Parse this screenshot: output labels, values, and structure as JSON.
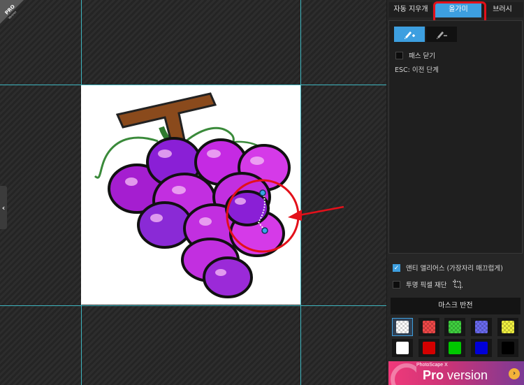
{
  "badge": {
    "line1": "PRO",
    "line2": "Version"
  },
  "tabs": [
    {
      "label": "자동 지우개"
    },
    {
      "label": "올가미"
    },
    {
      "label": "브러시"
    }
  ],
  "lasso": {
    "close_path_label": "패스 닫기",
    "esc_hint": "ESC: 이전 단계"
  },
  "options": {
    "antialias_label": "앤티 앨리어스 (가장자리 매끄럽게)",
    "antialias_checked": true,
    "crop_transparent_label": "투명 픽셀 재단"
  },
  "invert_mask_label": "마스크 반전",
  "mask_colors": [
    {
      "name": "transparent-checker",
      "color": "#ffffff"
    },
    {
      "name": "red-checker",
      "color": "#f04848"
    },
    {
      "name": "green-checker",
      "color": "#3fd13f"
    },
    {
      "name": "blue-checker",
      "color": "#6a6af0"
    },
    {
      "name": "yellow-checker",
      "color": "#f0f040"
    },
    {
      "name": "white",
      "color": "#ffffff"
    },
    {
      "name": "red",
      "color": "#d40000"
    },
    {
      "name": "green",
      "color": "#00c800"
    },
    {
      "name": "blue",
      "color": "#0000d8"
    },
    {
      "name": "black",
      "color": "#000000"
    }
  ],
  "ad": {
    "small": "PhotoScape X",
    "strong": "Pro",
    "rest": " version",
    "arrow": "›"
  },
  "colors": {
    "accent": "#3d9fe0",
    "highlight_red": "#e3101a",
    "guide": "#3fb6c0"
  }
}
